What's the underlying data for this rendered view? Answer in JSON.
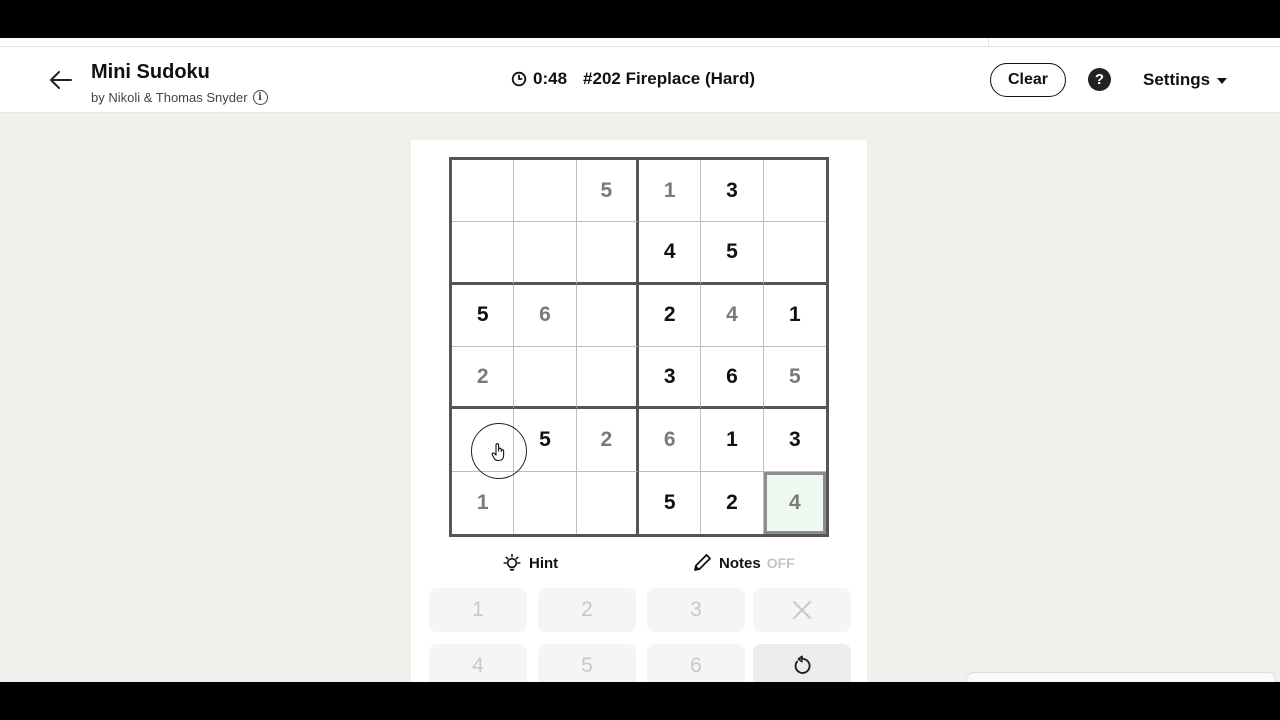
{
  "header": {
    "title": "Mini Sudoku",
    "byline": "by Nikoli & Thomas Snyder",
    "timer": "0:48",
    "puzzle_label": "#202 Fireplace (Hard)",
    "clear_label": "Clear",
    "help_label": "?",
    "settings_label": "Settings"
  },
  "board": {
    "rows": [
      [
        {
          "v": "",
          "t": "empty"
        },
        {
          "v": "",
          "t": "empty"
        },
        {
          "v": "5",
          "t": "entry"
        },
        {
          "v": "1",
          "t": "entry"
        },
        {
          "v": "3",
          "t": "given"
        },
        {
          "v": "",
          "t": "empty"
        }
      ],
      [
        {
          "v": "",
          "t": "empty"
        },
        {
          "v": "",
          "t": "empty"
        },
        {
          "v": "",
          "t": "empty"
        },
        {
          "v": "4",
          "t": "given"
        },
        {
          "v": "5",
          "t": "given"
        },
        {
          "v": "",
          "t": "empty"
        }
      ],
      [
        {
          "v": "5",
          "t": "given"
        },
        {
          "v": "6",
          "t": "entry"
        },
        {
          "v": "",
          "t": "empty"
        },
        {
          "v": "2",
          "t": "given"
        },
        {
          "v": "4",
          "t": "entry"
        },
        {
          "v": "1",
          "t": "given"
        }
      ],
      [
        {
          "v": "2",
          "t": "entry"
        },
        {
          "v": "",
          "t": "empty"
        },
        {
          "v": "",
          "t": "empty"
        },
        {
          "v": "3",
          "t": "given"
        },
        {
          "v": "6",
          "t": "given"
        },
        {
          "v": "5",
          "t": "entry"
        }
      ],
      [
        {
          "v": "",
          "t": "empty"
        },
        {
          "v": "5",
          "t": "given"
        },
        {
          "v": "2",
          "t": "entry"
        },
        {
          "v": "6",
          "t": "entry"
        },
        {
          "v": "1",
          "t": "given"
        },
        {
          "v": "3",
          "t": "given"
        }
      ],
      [
        {
          "v": "1",
          "t": "entry"
        },
        {
          "v": "",
          "t": "empty"
        },
        {
          "v": "",
          "t": "empty"
        },
        {
          "v": "5",
          "t": "given"
        },
        {
          "v": "2",
          "t": "given"
        },
        {
          "v": "4",
          "t": "entry"
        }
      ]
    ],
    "selected": [
      5,
      5
    ],
    "selected_color": "#eefaf1"
  },
  "tools": {
    "hint_label": "Hint",
    "notes_label": "Notes",
    "notes_state": "OFF"
  },
  "numpad": {
    "keys": [
      "1",
      "2",
      "3",
      "4",
      "5",
      "6"
    ],
    "erase_icon": "close-icon",
    "undo_icon": "undo-icon"
  }
}
